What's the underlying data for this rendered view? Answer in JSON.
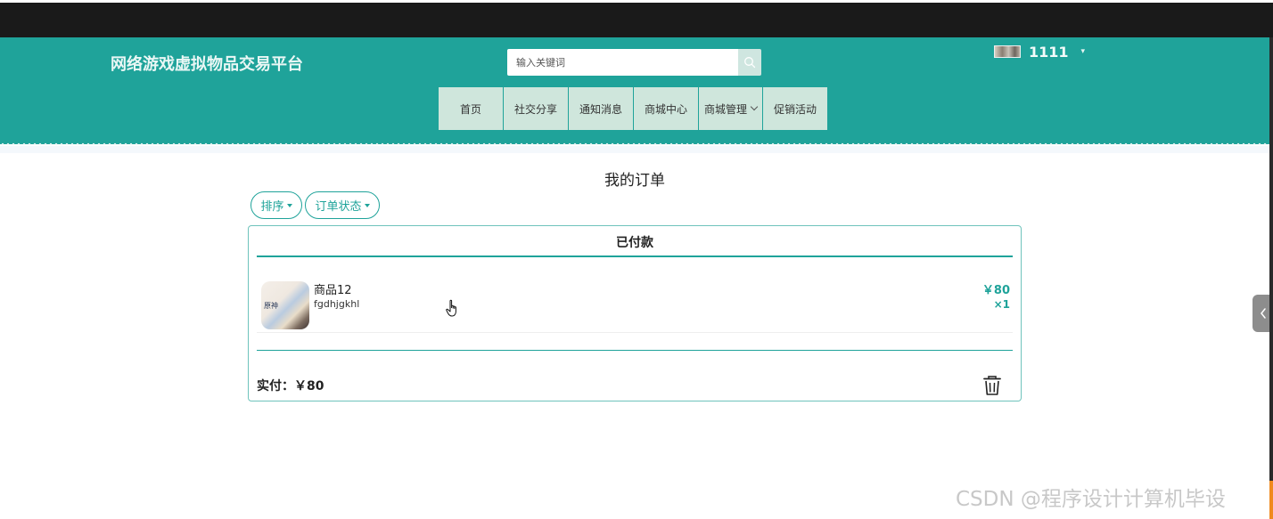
{
  "header": {
    "site_title": "网络游戏虚拟物品交易平台",
    "search_placeholder": "输入关键词",
    "username": "1111"
  },
  "nav": {
    "items": [
      {
        "label": "首页"
      },
      {
        "label": "社交分享"
      },
      {
        "label": "通知消息"
      },
      {
        "label": "商城中心"
      },
      {
        "label": "商城管理"
      },
      {
        "label": "促销活动"
      }
    ]
  },
  "page": {
    "title": "我的订单",
    "filters": [
      {
        "label": "排序"
      },
      {
        "label": "订单状态"
      }
    ]
  },
  "order": {
    "status": "已付款",
    "item": {
      "name": "商品12",
      "desc": "fgdhjgkhl",
      "price": "￥80",
      "qty": "×1",
      "thumb_text": "原神"
    },
    "total_label": "实付：￥80"
  },
  "watermark": "CSDN @程序设计计算机毕设",
  "colors": {
    "brand": "#1fa39a",
    "nav_bg": "#cfe6dc",
    "topbar": "#1a1a1a"
  },
  "icons": [
    "search-icon",
    "caret-down-icon",
    "chevron-down-icon",
    "trash-icon",
    "chevron-left-icon",
    "hand-cursor-icon"
  ]
}
